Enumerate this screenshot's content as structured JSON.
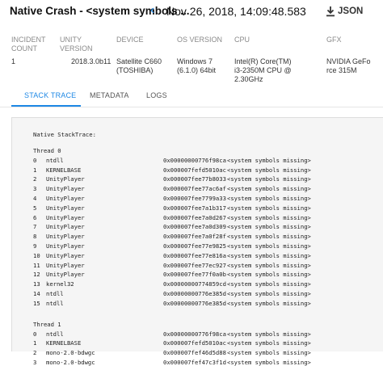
{
  "header": {
    "title": "Native Crash - <system symbols ...",
    "prev_icon": "chevron-left-icon",
    "datetime": "Nov 26, 2018, 14:09:48.583",
    "json_label": "JSON",
    "json_icon": "download-icon"
  },
  "details": [
    {
      "label": "INCIDENT COUNT",
      "value": "1"
    },
    {
      "label": "UNITY VERSION",
      "value": "2018.3.0b11"
    },
    {
      "label": "DEVICE",
      "value": "Satellite C660 (TOSHIBA)"
    },
    {
      "label": "OS VERSION",
      "value": "Windows 7 (6.1.0) 64bit"
    },
    {
      "label": "CPU",
      "value": "Intel(R) Core(TM) i3-2350M CPU @ 2.30GHz"
    },
    {
      "label": "GFX",
      "value": "NVIDIA GeForce 315M"
    }
  ],
  "tabs": [
    {
      "label": "STACK TRACE",
      "active": true
    },
    {
      "label": "METADATA",
      "active": false
    },
    {
      "label": "LOGS",
      "active": false
    }
  ],
  "stack": {
    "header": "Native StackTrace:",
    "threads": [
      {
        "title": "Thread 0",
        "frames": [
          {
            "idx": "0",
            "module": "ntdll",
            "addr": "0x00000000776f98ca",
            "symbol": "<system symbols missing>"
          },
          {
            "idx": "1",
            "module": "KERNELBASE",
            "addr": "0x000007fefd5010ac",
            "symbol": "<system symbols missing>"
          },
          {
            "idx": "2",
            "module": "UnityPlayer",
            "addr": "0x000007fee77b8033",
            "symbol": "<system symbols missing>"
          },
          {
            "idx": "3",
            "module": "UnityPlayer",
            "addr": "0x000007fee77ac6af",
            "symbol": "<system symbols missing>"
          },
          {
            "idx": "4",
            "module": "UnityPlayer",
            "addr": "0x000007fee7799a33",
            "symbol": "<system symbols missing>"
          },
          {
            "idx": "5",
            "module": "UnityPlayer",
            "addr": "0x000007fee7a1b317",
            "symbol": "<system symbols missing>"
          },
          {
            "idx": "6",
            "module": "UnityPlayer",
            "addr": "0x000007fee7a0d267",
            "symbol": "<system symbols missing>"
          },
          {
            "idx": "7",
            "module": "UnityPlayer",
            "addr": "0x000007fee7a0d309",
            "symbol": "<system symbols missing>"
          },
          {
            "idx": "8",
            "module": "UnityPlayer",
            "addr": "0x000007fee7a0f28f",
            "symbol": "<system symbols missing>"
          },
          {
            "idx": "9",
            "module": "UnityPlayer",
            "addr": "0x000007fee77e9825",
            "symbol": "<system symbols missing>"
          },
          {
            "idx": "10",
            "module": "UnityPlayer",
            "addr": "0x000007fee77e816a",
            "symbol": "<system symbols missing>"
          },
          {
            "idx": "11",
            "module": "UnityPlayer",
            "addr": "0x000007fee77ec927",
            "symbol": "<system symbols missing>"
          },
          {
            "idx": "12",
            "module": "UnityPlayer",
            "addr": "0x000007fee77f0a0b",
            "symbol": "<system symbols missing>"
          },
          {
            "idx": "13",
            "module": "kernel32",
            "addr": "0x00000000774859cd",
            "symbol": "<system symbols missing>"
          },
          {
            "idx": "14",
            "module": "ntdll",
            "addr": "0x00000000776e385d",
            "symbol": "<system symbols missing>"
          },
          {
            "idx": "15",
            "module": "ntdll",
            "addr": "0x00000000776e385d",
            "symbol": "<system symbols missing>"
          }
        ]
      },
      {
        "title": "Thread 1",
        "frames": [
          {
            "idx": "0",
            "module": "ntdll",
            "addr": "0x00000000776f98ca",
            "symbol": "<system symbols missing>"
          },
          {
            "idx": "1",
            "module": "KERNELBASE",
            "addr": "0x000007fefd5010ac",
            "symbol": "<system symbols missing>"
          },
          {
            "idx": "2",
            "module": "mono-2.0-bdwgc",
            "addr": "0x000007fef46d5d88",
            "symbol": "<system symbols missing>"
          },
          {
            "idx": "3",
            "module": "mono-2.0-bdwgc",
            "addr": "0x000007fef47c3f1d",
            "symbol": "<system symbols missing>"
          }
        ]
      }
    ]
  }
}
